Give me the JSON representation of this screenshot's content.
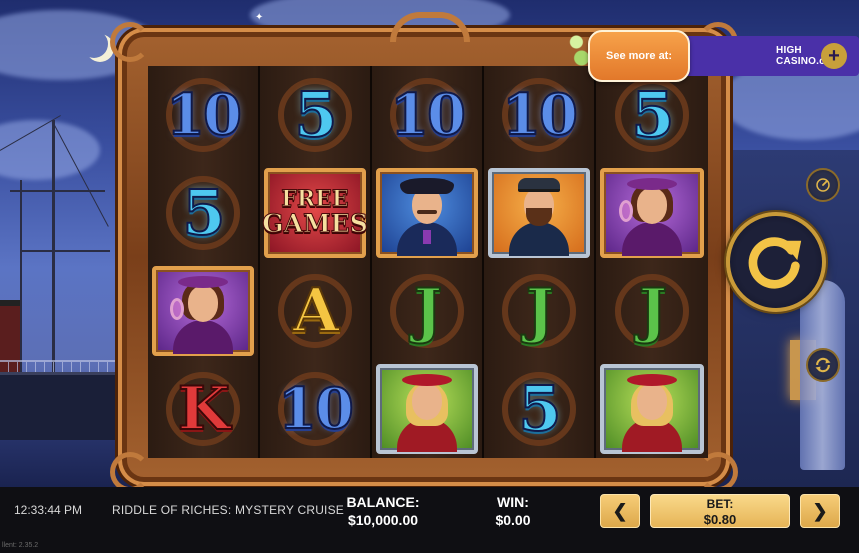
{
  "game": {
    "title": "RIDDLE OF RICHES: MYSTERY CRUISE",
    "clock": "12:33:44 PM",
    "version": "llent: 2.35.2"
  },
  "promo": {
    "see_more": "See more at:",
    "brand": "HIGH CASINO.com",
    "plus": "+"
  },
  "stats": {
    "balance_label": "BALANCE:",
    "balance_value": "$10,000.00",
    "win_label": "WIN:",
    "win_value": "$0.00",
    "bet_label": "BET:",
    "bet_value": "$0.80"
  },
  "controls": {
    "prev": "❮",
    "next": "❯",
    "spin": "spin-icon",
    "autoplay": "autoplay-icon",
    "speed": "turbo-icon"
  },
  "reels": [
    [
      "10",
      "5",
      "10",
      "10",
      "5"
    ],
    [
      "5",
      "FREE GAMES",
      "captain",
      "officer",
      "lady-purple"
    ],
    [
      "lady-purple",
      "A",
      "J",
      "J",
      "J"
    ],
    [
      "K",
      "10",
      "lady-green",
      "5",
      "lady-green"
    ]
  ],
  "symbols": {
    "free_games_l1": "FREE",
    "free_games_l2": "GAMES",
    "ten": "10",
    "five": "5",
    "ace": "A",
    "jack": "J",
    "king": "K"
  },
  "colors": {
    "accent_gold": "#e6b457",
    "promo_orange": "#f0913a",
    "promo_purple": "#4a30a8"
  }
}
